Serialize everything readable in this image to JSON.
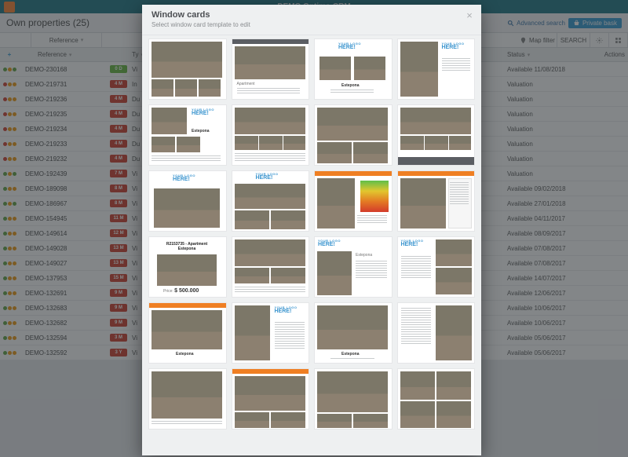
{
  "app": {
    "title": "DEMO Optima-CRM"
  },
  "page": {
    "heading": "Own properties (25)",
    "advancedSearch": "Advanced search",
    "privateBasket": "Private bask"
  },
  "toolbar": {
    "reference": "Reference",
    "mapFilter": "Map filter",
    "search": "SEARCH"
  },
  "gridHeader": {
    "plus": "+",
    "reference": "Reference",
    "ty": "Ty",
    "status": "Status",
    "actions": "Actions"
  },
  "rows": [
    {
      "dots": [
        "#6aa84f",
        "#f0a020",
        "#6aa84f"
      ],
      "ref": "DEMO-230168",
      "tag": "0 D",
      "tagColor": "#6fbd4a",
      "ty": "Vi",
      "status": "Available 11/08/2018"
    },
    {
      "dots": [
        "#d34b3b",
        "#f0a020",
        "#f0a020"
      ],
      "ref": "DEMO-219731",
      "tag": "4 M",
      "tagColor": "#d34b3b",
      "ty": "In",
      "status": "Valuation"
    },
    {
      "dots": [
        "#d34b3b",
        "#f0a020",
        "#f0a020"
      ],
      "ref": "DEMO-219236",
      "tag": "4 M",
      "tagColor": "#d34b3b",
      "ty": "Du",
      "status": "Valuation"
    },
    {
      "dots": [
        "#d34b3b",
        "#f0a020",
        "#f0a020"
      ],
      "ref": "DEMO-219235",
      "tag": "4 M",
      "tagColor": "#d34b3b",
      "ty": "Du",
      "status": "Valuation"
    },
    {
      "dots": [
        "#d34b3b",
        "#f0a020",
        "#f0a020"
      ],
      "ref": "DEMO-219234",
      "tag": "4 M",
      "tagColor": "#d34b3b",
      "ty": "Du",
      "status": "Valuation"
    },
    {
      "dots": [
        "#d34b3b",
        "#f0a020",
        "#f0a020"
      ],
      "ref": "DEMO-219233",
      "tag": "4 M",
      "tagColor": "#d34b3b",
      "ty": "Du",
      "status": "Valuation"
    },
    {
      "dots": [
        "#d34b3b",
        "#f0a020",
        "#f0a020"
      ],
      "ref": "DEMO-219232",
      "tag": "4 M",
      "tagColor": "#d34b3b",
      "ty": "Du",
      "status": "Valuation"
    },
    {
      "dots": [
        "#6aa84f",
        "#f0a020",
        "#6aa84f"
      ],
      "ref": "DEMO-192439",
      "tag": "7 M",
      "tagColor": "#d34b3b",
      "ty": "Vi",
      "status": "Valuation"
    },
    {
      "dots": [
        "#6aa84f",
        "#f0a020",
        "#f0a020"
      ],
      "ref": "DEMO-189098",
      "tag": "8 M",
      "tagColor": "#d34b3b",
      "ty": "Vi",
      "status": "Available 09/02/2018"
    },
    {
      "dots": [
        "#6aa84f",
        "#f0a020",
        "#6aa84f"
      ],
      "ref": "DEMO-186967",
      "tag": "8 M",
      "tagColor": "#d34b3b",
      "ty": "Vi",
      "status": "Available 27/01/2018"
    },
    {
      "dots": [
        "#6aa84f",
        "#f0a020",
        "#f0a020"
      ],
      "ref": "DEMO-154945",
      "tag": "11 M",
      "tagColor": "#d34b3b",
      "ty": "Vi",
      "status": "Available 04/11/2017"
    },
    {
      "dots": [
        "#6aa84f",
        "#f0a020",
        "#f0a020"
      ],
      "ref": "DEMO-149614",
      "tag": "12 M",
      "tagColor": "#d34b3b",
      "ty": "Vi",
      "status": "Available 08/09/2017"
    },
    {
      "dots": [
        "#6aa84f",
        "#f0a020",
        "#f0a020"
      ],
      "ref": "DEMO-149028",
      "tag": "13 M",
      "tagColor": "#d34b3b",
      "ty": "Vi",
      "status": "Available 07/08/2017"
    },
    {
      "dots": [
        "#6aa84f",
        "#f0a020",
        "#f0a020"
      ],
      "ref": "DEMO-149027",
      "tag": "13 M",
      "tagColor": "#d34b3b",
      "ty": "Vi",
      "status": "Available 07/08/2017"
    },
    {
      "dots": [
        "#6aa84f",
        "#f0a020",
        "#f0a020"
      ],
      "ref": "DEMO-137953",
      "tag": "15 M",
      "tagColor": "#d34b3b",
      "ty": "Vi",
      "status": "Available 14/07/2017"
    },
    {
      "dots": [
        "#6aa84f",
        "#f0a020",
        "#f0a020"
      ],
      "ref": "DEMO-132691",
      "tag": "9 M",
      "tagColor": "#d34b3b",
      "ty": "Vi",
      "status": "Available 12/06/2017"
    },
    {
      "dots": [
        "#6aa84f",
        "#f0a020",
        "#f0a020"
      ],
      "ref": "DEMO-132683",
      "tag": "9 M",
      "tagColor": "#d34b3b",
      "ty": "Vi",
      "status": "Available 10/06/2017"
    },
    {
      "dots": [
        "#6aa84f",
        "#f0a020",
        "#f0a020"
      ],
      "ref": "DEMO-132682",
      "tag": "9 M",
      "tagColor": "#d34b3b",
      "ty": "Vi",
      "status": "Available 10/06/2017"
    },
    {
      "dots": [
        "#6aa84f",
        "#f0a020",
        "#f0a020"
      ],
      "ref": "DEMO-132594",
      "tag": "3 M",
      "tagColor": "#d34b3b",
      "ty": "Vi",
      "status": "Available 05/06/2017"
    },
    {
      "dots": [
        "#6aa84f",
        "#f0a020",
        "#f0a020"
      ],
      "ref": "DEMO-132592",
      "tag": "3 Y",
      "tagColor": "#d34b3b",
      "ty": "Vi",
      "status": "Available 05/06/2017"
    }
  ],
  "modal": {
    "title": "Window cards",
    "subtitle": "Select window card template to edit",
    "logoText": "YOUR LOGO",
    "logoHere": "HERE!",
    "sampleRef": "R2153735 - Apartment",
    "sampleLoc": "Estepona",
    "samplePriceLabel": "Price:",
    "samplePrice": "$ 500.000",
    "sampleLoc2": "Estepona",
    "sampleApt": "Apartment"
  }
}
